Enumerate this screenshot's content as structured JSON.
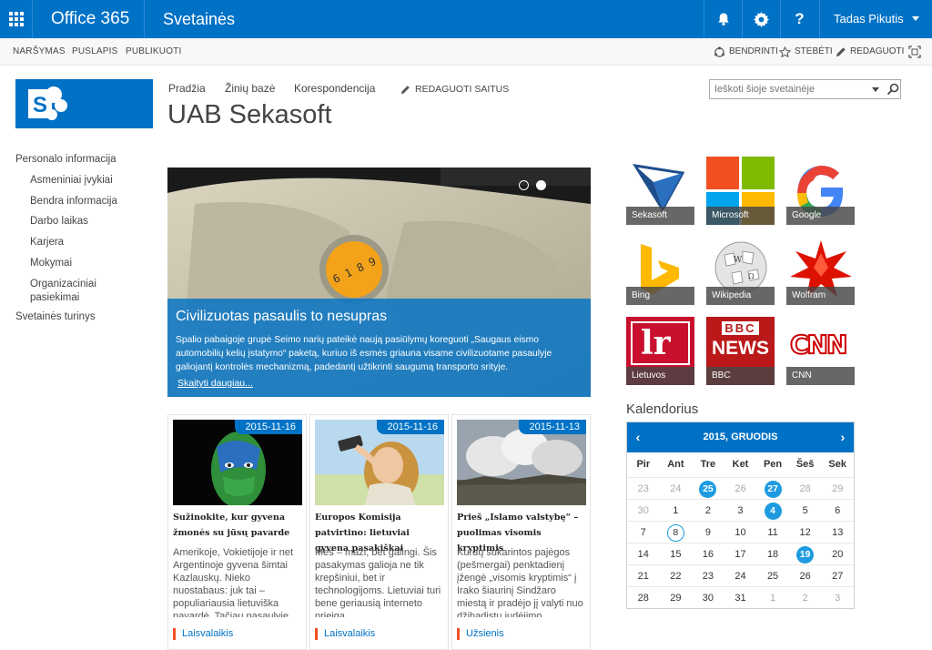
{
  "suitebar": {
    "brand": "Office 365",
    "site": "Svetainės",
    "user": "Tadas Pikutis"
  },
  "ribbon": {
    "tabs": [
      "NARŠYMAS",
      "PUSLAPIS",
      "PUBLIKUOTI"
    ],
    "actions": [
      "BENDRINTI",
      "STEBĖTI",
      "REDAGUOTI"
    ]
  },
  "header": {
    "topnav": [
      "Pradžia",
      "Žinių bazė",
      "Korespondencija"
    ],
    "edit_links": "REDAGUOTI SAITUS",
    "title": "UAB Sekasoft",
    "search_placeholder": "Ieškoti šioje svetainėje"
  },
  "leftnav": {
    "section1": "Personalo informacija",
    "items": [
      "Asmeniniai įvykiai",
      "Bendra informacija",
      "Darbo laikas",
      "Karjera",
      "Mokymai"
    ],
    "item_org_1": "Organizaciniai",
    "item_org_2": "pasiekimai",
    "section2": "Svetainės turinys"
  },
  "slider": {
    "title": "Civilizuotas pasaulis to nesupras",
    "text": "Spalio pabaigoje grupė Seimo narių pateikė naują pasiūlymų koreguoti „Saugaus eismo automobilių kelių įstatymo“ paketą, kuriuo iš esmės griauna visame civilizuotame pasaulyje galiojantį kontrolės mechanizmą, padedantį užtikrinti saugumą transporto srityje.",
    "more": "Skaityti daugiau..."
  },
  "news": [
    {
      "date": "2015-11-16",
      "title": "Sužinokite, kur gyvena žmonės su jūsų pavarde",
      "text": "Amerikoje, Vokietijoje ir net Argentinoje gyvena šimtai Kazlauskų. Nieko nuostabaus: juk tai – populiariausia lietuviška pavardė. Tačiau pasaulyje",
      "tag": "Laisvalaikis"
    },
    {
      "date": "2015-11-16",
      "title": "Europos Komisija patvirtino: lietuviai gyvena pasakiškai",
      "text": "Mes – maži, bet galingi. Šis pasakymas galioja ne tik krepšiniui, bet ir technologijoms. Lietuviai turi bene geriausią interneto prieigą",
      "tag": "Laisvalaikis"
    },
    {
      "date": "2015-11-13",
      "title": "Prieš „Islamo valstybę“ – puolimas visomis kryptimis",
      "text": "Kurdų sukarintos pajėgos (pešmergai) penktadienį įžengė „visomis kryptimis“ į Irako šiaurinį Sindžaro miestą ir pradėjo jį valyti nuo džihadistų judėjimo",
      "tag": "Užsienis"
    }
  ],
  "tiles": [
    {
      "label": "Sekasoft"
    },
    {
      "label": "Microsoft"
    },
    {
      "label": "Google"
    },
    {
      "label": "Bing"
    },
    {
      "label": "Wikipedia"
    },
    {
      "label": "Wolfram"
    },
    {
      "label": "Lietuvos"
    },
    {
      "label": "BBC"
    },
    {
      "label": "CNN"
    }
  ],
  "tile_logo_text": {
    "lr": "lr",
    "bbc_top": "BBC",
    "bbc_bottom": "NEWS",
    "cnn": "CNN"
  },
  "calendar": {
    "heading": "Kalendorius",
    "month": "2015, GRUODIS",
    "prev": "‹",
    "next": "›",
    "weekdays": [
      "Pir",
      "Ant",
      "Tre",
      "Ket",
      "Pen",
      "Šeš",
      "Sek"
    ],
    "weeks": [
      [
        "23",
        "24",
        "25",
        "26",
        "27",
        "28",
        "29"
      ],
      [
        "30",
        "1",
        "2",
        "3",
        "4",
        "5",
        "6"
      ],
      [
        "7",
        "8",
        "9",
        "10",
        "11",
        "12",
        "13"
      ],
      [
        "14",
        "15",
        "16",
        "17",
        "18",
        "19",
        "20"
      ],
      [
        "21",
        "22",
        "23",
        "24",
        "25",
        "26",
        "27"
      ],
      [
        "28",
        "29",
        "30",
        "31",
        "1",
        "2",
        "3"
      ]
    ]
  },
  "colors": {
    "suite_blue": "#0072c6",
    "event_blue": "#1e9be0",
    "tag_orange": "#f25022"
  }
}
